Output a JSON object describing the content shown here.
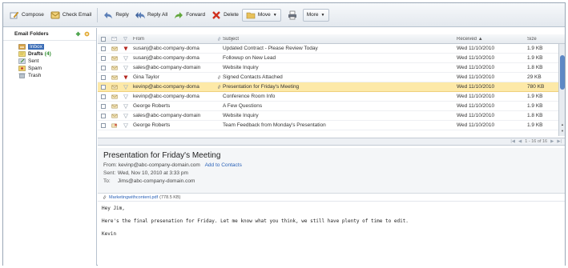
{
  "toolbar": {
    "compose": "Compose",
    "check_email": "Check Email",
    "reply": "Reply",
    "reply_all": "Reply All",
    "forward": "Forward",
    "delete": "Delete",
    "move": "Move",
    "more": "More"
  },
  "folders": {
    "header": "Email Folders",
    "items": [
      {
        "label": "Inbox",
        "count": ""
      },
      {
        "label": "Drafts",
        "count": "(4)"
      },
      {
        "label": "Sent",
        "count": ""
      },
      {
        "label": "Spam",
        "count": ""
      },
      {
        "label": "Trash",
        "count": ""
      }
    ]
  },
  "list": {
    "columns": {
      "from": "From",
      "subject": "Subject",
      "received": "Received",
      "size": "Size"
    },
    "rows": [
      {
        "from": "susanj@abc-company-doma",
        "subject": "Updated Contract - Please Review Today",
        "received": "Wed 11/10/2010",
        "size": "1.9 KB"
      },
      {
        "from": "susanj@abc-company-doma",
        "subject": "Followup on New Lead",
        "received": "Wed 11/10/2010",
        "size": "1.9 KB"
      },
      {
        "from": "sales@abc-company-domain",
        "subject": "Website Inquiry",
        "received": "Wed 11/10/2010",
        "size": "1.8 KB"
      },
      {
        "from": "Gina Taylor",
        "subject": "Signed Contacts Attached",
        "received": "Wed 11/10/2010",
        "size": "29 KB"
      },
      {
        "from": "kevinp@abc-company-doma",
        "subject": "Presentation for Friday's Meeting",
        "received": "Wed 11/10/2010",
        "size": "780 KB"
      },
      {
        "from": "kevinp@abc-company-doma",
        "subject": "Conference Room Info",
        "received": "Wed 11/10/2010",
        "size": "1.9 KB"
      },
      {
        "from": "George Roberts",
        "subject": "A Few Questions",
        "received": "Wed 11/10/2010",
        "size": "1.9 KB"
      },
      {
        "from": "sales@abc-company-domain",
        "subject": "Website Inquiry",
        "received": "Wed 11/10/2010",
        "size": "1.8 KB"
      },
      {
        "from": "George Roberts",
        "subject": "Team Feedback from Monday's Presentation",
        "received": "Wed 11/10/2010",
        "size": "1.9 KB"
      }
    ],
    "pager": "1 - 16 of 16"
  },
  "preview": {
    "title": "Presentation for Friday's Meeting",
    "from_label": "From:",
    "from_value": "kevinp@abc-company-domain.com",
    "add_contacts": "Add to Contacts",
    "sent_label": "Sent:",
    "sent_value": "Wed, Nov 10, 2010 at 3:33 pm",
    "to_label": "To:",
    "to_value": "Jims@abc-company-domain.com",
    "attachment_name": "Marketingwithcontent.pdf",
    "attachment_size": "(778.5 KB)",
    "body_greeting": "Hey Jim,",
    "body_text": "Here's the final presenation for Friday. Let me know what you think, we still have plenty of time to edit.",
    "body_sign": "Kevin"
  }
}
